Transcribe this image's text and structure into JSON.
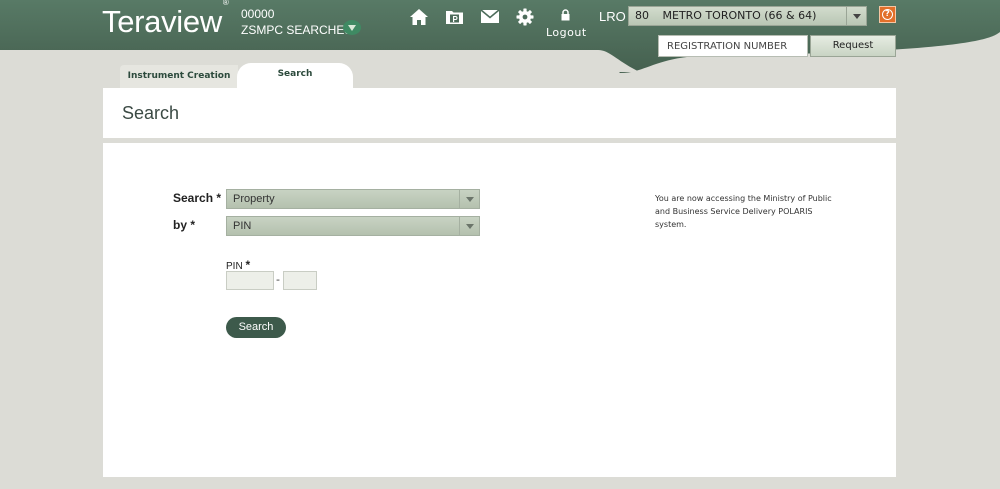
{
  "header": {
    "logo": "Teraview",
    "logo_mark": "®",
    "account_number": "00000",
    "account_name": "ZSMPC SEARCHES",
    "nav_icons": [
      "home-icon",
      "parcel-register-icon",
      "mail-icon",
      "settings-icon"
    ],
    "logout_label": "Logout",
    "lro_label": "LRO",
    "lro_code": "80",
    "lro_name": "METRO TORONTO (66 & 64)",
    "registration_placeholder": "REGISTRATION NUMBER",
    "request_label": "Request",
    "help_label": "?"
  },
  "tabs": [
    {
      "label": "Instrument Creation",
      "active": false
    },
    {
      "label": "Search",
      "active": true
    }
  ],
  "page_title": "Search",
  "form": {
    "search_label": "Search *",
    "search_value": "Property",
    "by_label": "by *",
    "by_value": "PIN",
    "pin_label": "PIN",
    "pin_required": "*",
    "pin_separator": "-",
    "search_button": "Search"
  },
  "notice": "You are now accessing the Ministry of Public and Business Service Delivery POLARIS system.",
  "colors": {
    "header": "#4d6c5b",
    "accent_button": "#3d5a4b",
    "help": "#e2702a"
  }
}
